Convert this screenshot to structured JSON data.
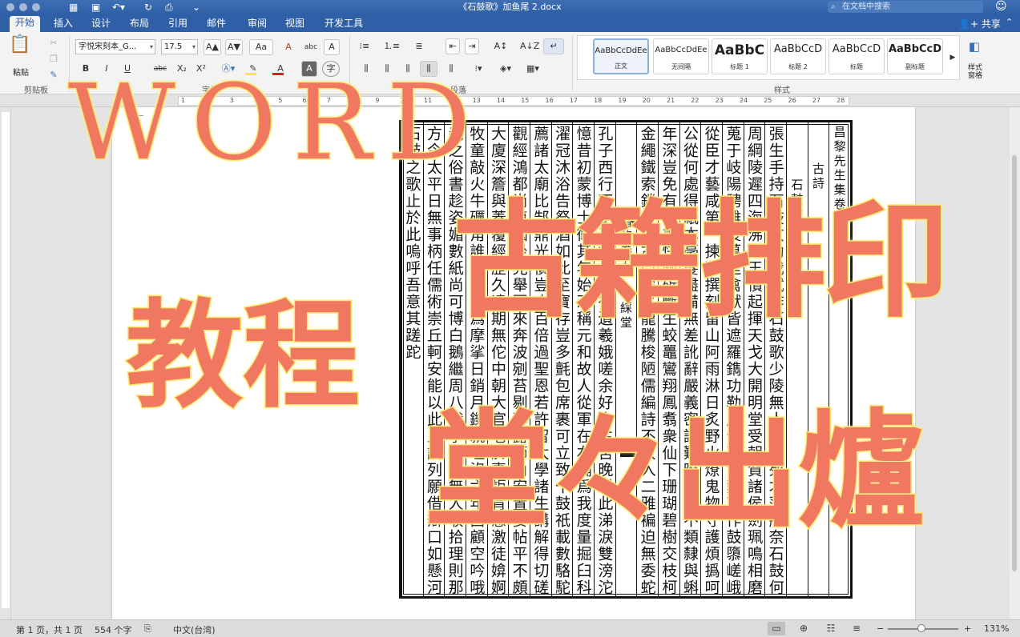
{
  "window": {
    "title": "《石鼓歌》加鱼尾 2.docx",
    "search_placeholder": "在文档中搜索",
    "quick_access": [
      "grid-icon",
      "save-icon",
      "undo-icon",
      "redo-icon",
      "print-icon",
      "customize-icon"
    ]
  },
  "tabs": [
    "开始",
    "插入",
    "设计",
    "布局",
    "引用",
    "邮件",
    "审阅",
    "视图",
    "开发工具"
  ],
  "active_tab": "开始",
  "share_label": "共享",
  "ribbon": {
    "clipboard": {
      "paste_label": "粘贴",
      "group_label": "剪贴板"
    },
    "font": {
      "font_name": "字悦宋刻本_G...",
      "font_size": "17.5",
      "group_label": "字体",
      "format_buttons": [
        "B",
        "I",
        "U",
        "abc",
        "X₂",
        "X²"
      ],
      "grow": "A▲",
      "shrink": "A▼",
      "change_case": "Aa",
      "clear_format": "A",
      "phonetic": "abc",
      "char_border": "A",
      "enclose": "字",
      "highlight_color": "#f7e84a",
      "font_color": "#d42020"
    },
    "paragraph": {
      "group_label": "段落"
    },
    "styles": {
      "group_label": "样式",
      "items": [
        {
          "sample": "AaBbCcDdEe",
          "name": "正文"
        },
        {
          "sample": "AaBbCcDdEe",
          "name": "无间隔"
        },
        {
          "sample": "AaBbC",
          "name": "标题 1"
        },
        {
          "sample": "AaBbCcD",
          "name": "标题 2"
        },
        {
          "sample": "AaBbCcD",
          "name": "标题"
        },
        {
          "sample": "AaBbCcD",
          "name": "副标题"
        }
      ],
      "pane_label": "样式\n窗格"
    }
  },
  "ruler": {
    "numbers": [
      "1",
      "2",
      "3",
      "4",
      "5",
      "6",
      "7",
      "8",
      "9",
      "10",
      "11",
      "12",
      "13",
      "14",
      "15",
      "16",
      "17",
      "18",
      "19",
      "20",
      "21",
      "22",
      "23",
      "24",
      "25",
      "26",
      "27",
      "28"
    ]
  },
  "document": {
    "columns": [
      "昌黎先生集卷之五",
      "古詩",
      "石鼓歌　韓",
      "張生手持石鼓文勸我試作石鼓歌少陵無人謫仙死才薄將奈石鼓何",
      "周綱陵遲四海沸宣王憤起揮天戈大開明堂受朝賀諸侯劍珮鳴相磨",
      "蒐于岐陽騁雄俊萬里禽獸皆遮羅鐫功勒成告萬世鑿石作鼓隳嵯峨",
      "從臣才藝咸第一揀選撰刻留山阿雨淋日炙野火燎鬼物守護煩撝呵",
      "公從何處得紙本毫髮盡備無差訛辭嚴義密讀難曉字體不類隸與蝌",
      "年深豈免有缺畫快劍斫斷生蛟鼉鸞翔鳳翥衆仙下珊瑚碧樹交枝柯",
      "金繩鐵索鎖紐壯古鼎躍水龍騰梭陋儒編詩不收入二雅褊迫無委蛇",
      "昌黎卷五　世綵堂",
      "孔子西行不到秦掎摭星宿遺羲娥嗟余好古生苦晚對此涕淚雙滂沱",
      "憶昔初蒙博士徵其年始改稱元和故人從軍在右輔爲我度量掘臼科",
      "濯冠沐浴告祭酒如此至寶存豈多氈包席裹可立致十鼓祇載數駱駝",
      "薦諸太廟比郜鼎光價豈止百倍過聖恩若許留太學諸生講解得切磋",
      "觀經鴻都尚填咽坐見舉國來奔波剜苔剔蘚露節角安置妥帖平不頗",
      "大廈深簷與蓋覆經歷久遠期無佗中朝大官老於事詎肯感激徒媕婀",
      "牧童敲火牛礪角誰復著手爲摩挲日銷月鑠就埋沒六年西顧空吟哦",
      "羲之俗書趁姿媚數紙尚可博白鵝繼周八代爭戰罷無人收拾理則那",
      "方今太平日無事柄任儒術崇丘軻安能以此上論列願借辯口如懸河",
      "石鼓之歌止於此嗚呼吾意其蹉跎"
    ]
  },
  "overlay": {
    "line1": "WORD",
    "line2": "古籍排印",
    "line3": "教程",
    "line4": "堂々出爐"
  },
  "status": {
    "page": "第 1 页，共 1 页",
    "words": "554 个字",
    "language": "中文(台湾)",
    "zoom": "131%",
    "zoom_fraction": 0.48
  }
}
